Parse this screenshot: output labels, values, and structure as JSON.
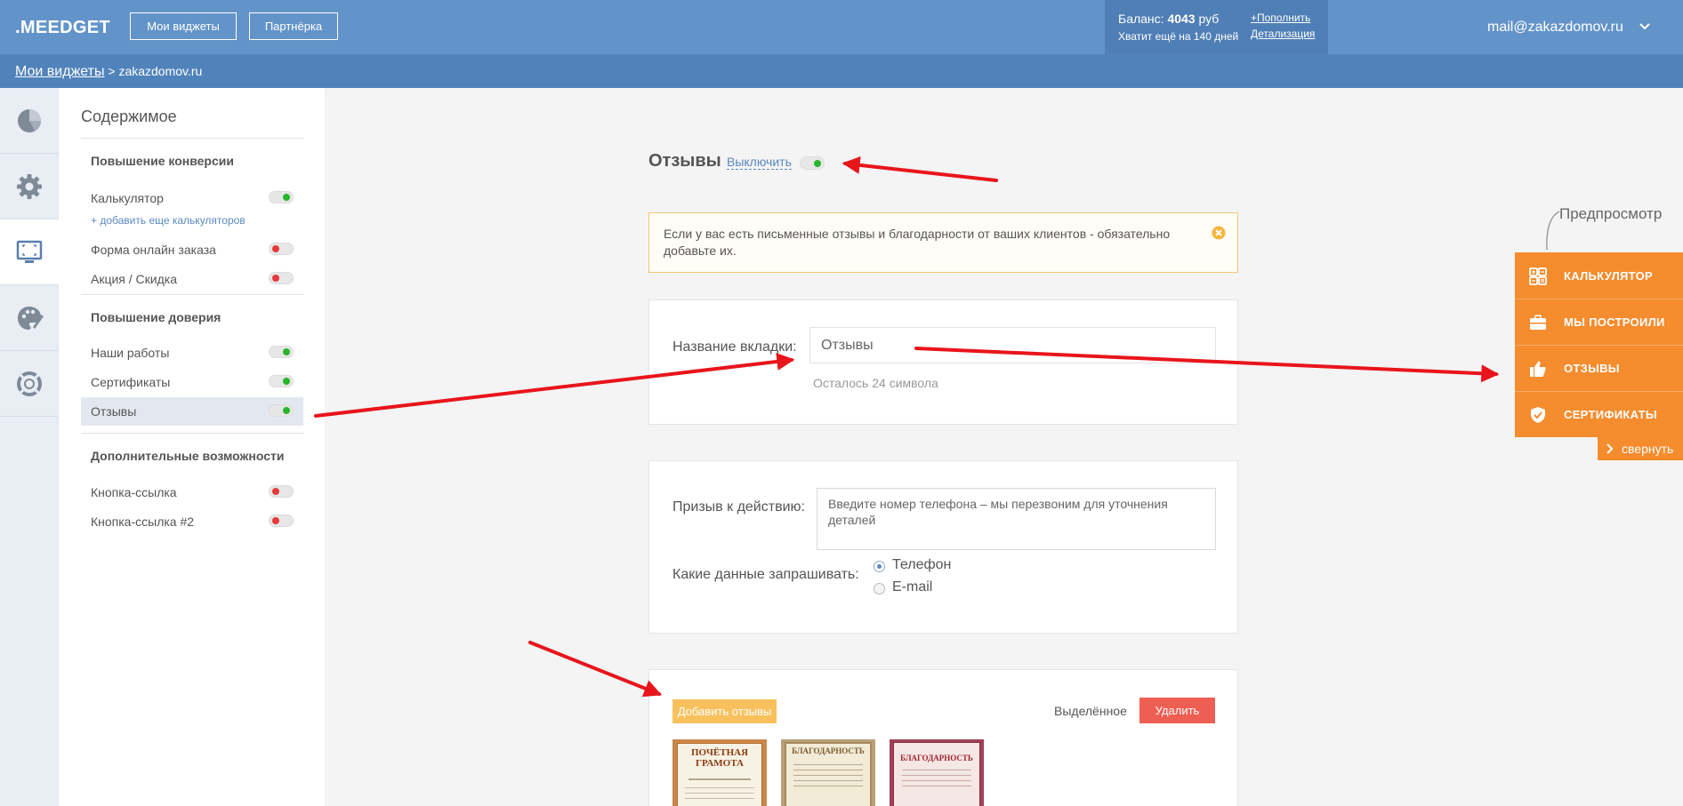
{
  "header": {
    "logo": ".MEEDGET",
    "nav_my_widgets": "Мои виджеты",
    "nav_partner": "Партнёрка",
    "balance_label": "Баланс: ",
    "balance_amount": "4043",
    "balance_currency": " руб",
    "balance_days": "Хватит ещё на 140 дней",
    "topup_link": "+Пополнить",
    "details_link": "Детализация",
    "user_email": "mail@zakazdomov.ru"
  },
  "breadcrumb": {
    "root": "Мои виджеты",
    "separator": " > ",
    "current": "zakazdomov.ru"
  },
  "rail": {
    "icons": [
      "pie-chart-icon",
      "gear-icon",
      "screen-icon",
      "palette-icon",
      "lifebuoy-icon"
    ]
  },
  "menu": {
    "title": "Содержимое",
    "group1": "Повышение конверсии",
    "calculator": "Калькулятор",
    "add_calculators": "+ добавить еще калькуляторов",
    "online_order": "Форма онлайн заказа",
    "promo": "Акция / Скидка",
    "group2": "Повышение доверия",
    "our_works": "Наши работы",
    "certificates": "Сертификаты",
    "reviews": "Отзывы",
    "group3": "Дополнительные возможности",
    "link_button": "Кнопка-ссылка",
    "link_button_2": "Кнопка-ссылка #2"
  },
  "main": {
    "title": "Отзывы",
    "toggle_link": "Выключить",
    "notice": "Если у вас есть письменные отзывы и благодарности от ваших клиентов - обязательно добавьте их.",
    "tab_name_label": "Название вкладки:",
    "tab_name_value": "Отзывы",
    "chars_left": "Осталось 24 символа",
    "cta_label": "Призыв к действию:",
    "cta_value": "Введите номер телефона – мы перезвоним для уточнения деталей",
    "request_label": "Какие данные запрашивать:",
    "option_phone": "Телефон",
    "option_email": "E-mail",
    "add_reviews": "Добавить отзывы",
    "selected": "Выделённое",
    "delete": "Удалить",
    "thumb1_title": "ПОЧЁТНАЯ ГРАМОТА",
    "thumb2_title": "БЛАГОДАРНОСТЬ",
    "thumb3_title": "БЛАГОДАРНОСТЬ"
  },
  "preview": {
    "label": "Предпросмотр",
    "items": [
      "КАЛЬКУЛЯТОР",
      "МЫ ПОСТРОИЛИ",
      "ОТЗЫВЫ",
      "СЕРТИФИКАТЫ"
    ],
    "collapse": "свернуть"
  },
  "colors": {
    "header_bg": "#6394c9",
    "breadcrumb_bg": "#5183bb",
    "accent_orange": "#f58c2e",
    "toggle_on": "#2ab52a",
    "toggle_off": "#e63a3a",
    "delete_red": "#ef5e52",
    "add_yellow": "#f8c15d",
    "arrow_red": "#e8151b"
  }
}
